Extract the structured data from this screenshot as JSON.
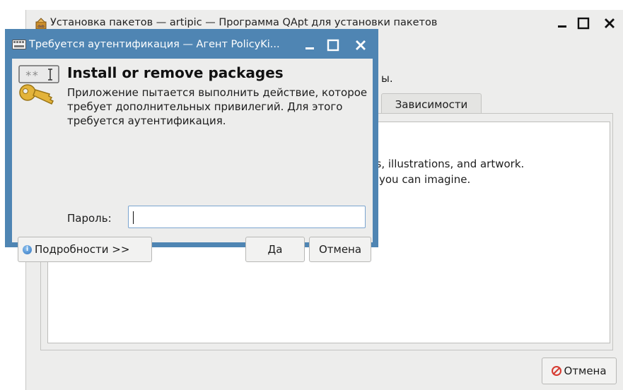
{
  "background_window": {
    "title": "Установка пакетов — artipic — Программа QApt для установки пакетов",
    "partial_status_text": "ы.",
    "tab_dependencies": "Зависимости",
    "description_line1": "hs, illustrations, and artwork.",
    "description_line2": "you can imagine.",
    "cancel_button": "Отмена"
  },
  "dialog": {
    "title": "Требуется аутентификация — Агент PolicyKi...",
    "heading": "Install or remove packages",
    "message": "Приложение пытается выполнить действие, которое требует дополнительных привилегий. Для этого требуется аутентификация.",
    "password_label": "Пароль:",
    "password_value": "",
    "details_button": "Подробности >>",
    "ok_button": "Да",
    "cancel_button": "Отмена"
  },
  "colors": {
    "dialog_accent": "#4f85b3",
    "window_bg": "#ededec",
    "stop_icon": "#d63a30"
  }
}
